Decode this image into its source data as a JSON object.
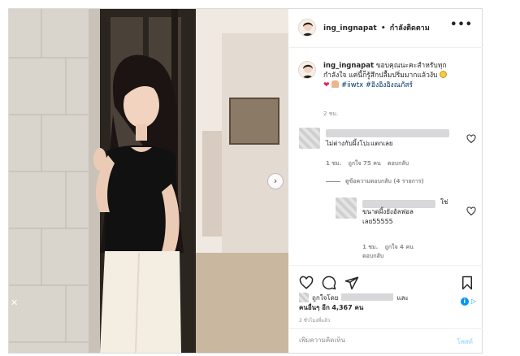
{
  "post": {
    "username": "ing_ingnapat",
    "header_separator": "•",
    "follow_status": "กำลังติดตาม",
    "more_icon": "more-horizontal-icon",
    "caption": {
      "username": "ing_ingnapat",
      "text_line1": "ขอบคุณนะคะสำหรับทุก",
      "text_line2": "กำลังใจ แค่นี้ก็รู้สึกปลื้มปริ่มมากแล้วงับ",
      "hashtags": "#iiwtx #อิงอิงอิงณภัสร์",
      "time": "2 ชม."
    }
  },
  "comments": [
    {
      "text": "ไม่ต่างกับผึ้งโปะแตกเลย",
      "time": "1 ชม.",
      "likes": "ถูกใจ 75 คน",
      "reply_label": "ตอบกลับ",
      "view_replies": "ดูข้อความตอบกลับ (4 รายการ)"
    },
    {
      "text_suffix": "ใช่",
      "text_line2": "ขนาดผึ้งยังอัลฟอล",
      "text_line3": "เลย55555",
      "time": "1 ชม.",
      "likes": "ถูกใจ 4 คน",
      "reply_label": "ตอบกลับ"
    }
  ],
  "actions": {
    "like_icon": "heart-icon",
    "comment_icon": "comment-icon",
    "share_icon": "share-icon",
    "save_icon": "bookmark-icon"
  },
  "likes_summary": {
    "prefix": "ถูกใจโดย",
    "and": "และ",
    "others_prefix": "คนอื่นๆ อีก",
    "others_count": "4,367 คน"
  },
  "time_ago": "2 ชั่วโมงที่แล้ว",
  "ad_choices": "i",
  "comment_input": {
    "placeholder": "เพิ่มความคิดเห็น",
    "post_label": "โพสต์"
  },
  "photo": {
    "next_arrow": "›",
    "close_glyph": "✕"
  }
}
